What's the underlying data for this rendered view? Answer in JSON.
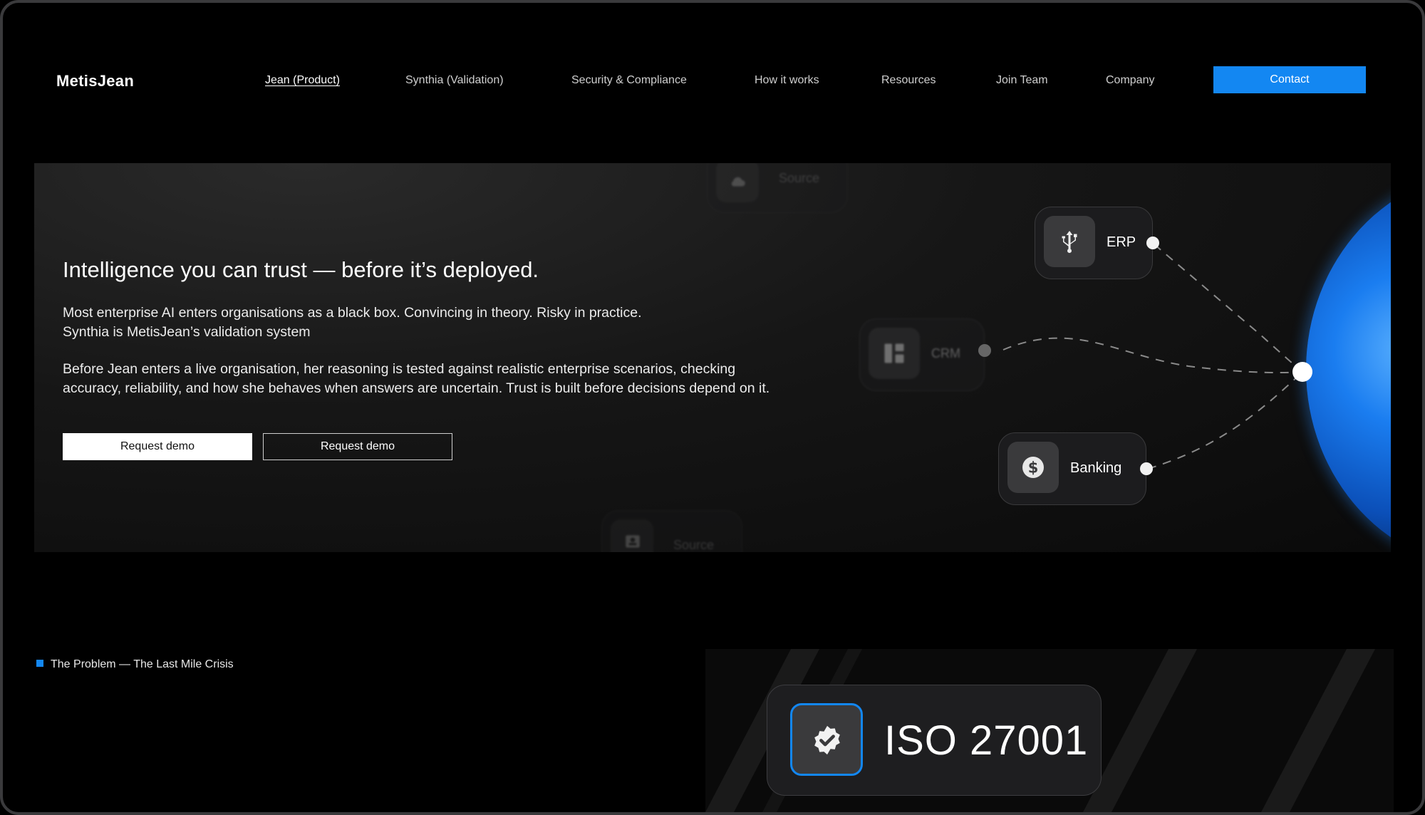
{
  "brand": {
    "name": "MetisJean"
  },
  "nav": {
    "items": [
      {
        "label": "Jean (Product)",
        "active": true
      },
      {
        "label": "Synthia (Validation)",
        "active": false
      },
      {
        "label": "Security & Compliance",
        "active": false
      },
      {
        "label": "How it works",
        "active": false
      },
      {
        "label": "Resources",
        "active": false
      },
      {
        "label": "Join Team",
        "active": false
      },
      {
        "label": "Company",
        "active": false
      }
    ],
    "contact_label": "Contact"
  },
  "hero": {
    "title": "Intelligence you can trust — before it’s deployed.",
    "paragraph1_line1": "Most enterprise AI enters organisations as a black box. Convincing in theory. Risky in practice.",
    "paragraph1_line2": "Synthia is MetisJean’s validation system",
    "paragraph2": "Before Jean enters a live organisation, her reasoning is tested against realistic enterprise scenarios, checking accuracy, reliability, and how she behaves when answers are uncertain. Trust is built before decisions depend on it.",
    "primary_button": "Request demo",
    "secondary_button": "Request demo"
  },
  "diagram": {
    "nodes": [
      {
        "label": "ERP",
        "icon": "usb-icon"
      },
      {
        "label": "CRM",
        "icon": "dashboard-icon"
      },
      {
        "label": "Banking",
        "icon": "dollar-icon"
      },
      {
        "label": "Source",
        "icon": "cloud-icon"
      },
      {
        "label": "Source",
        "icon": "contact-card-icon"
      }
    ]
  },
  "problem": {
    "label": "The Problem — The Last Mile Crisis"
  },
  "certification": {
    "label": "ISO 27001",
    "icon": "verified-badge-icon"
  },
  "colors": {
    "accent": "#1387f2",
    "background": "#000000",
    "card": "#1e1e20"
  }
}
